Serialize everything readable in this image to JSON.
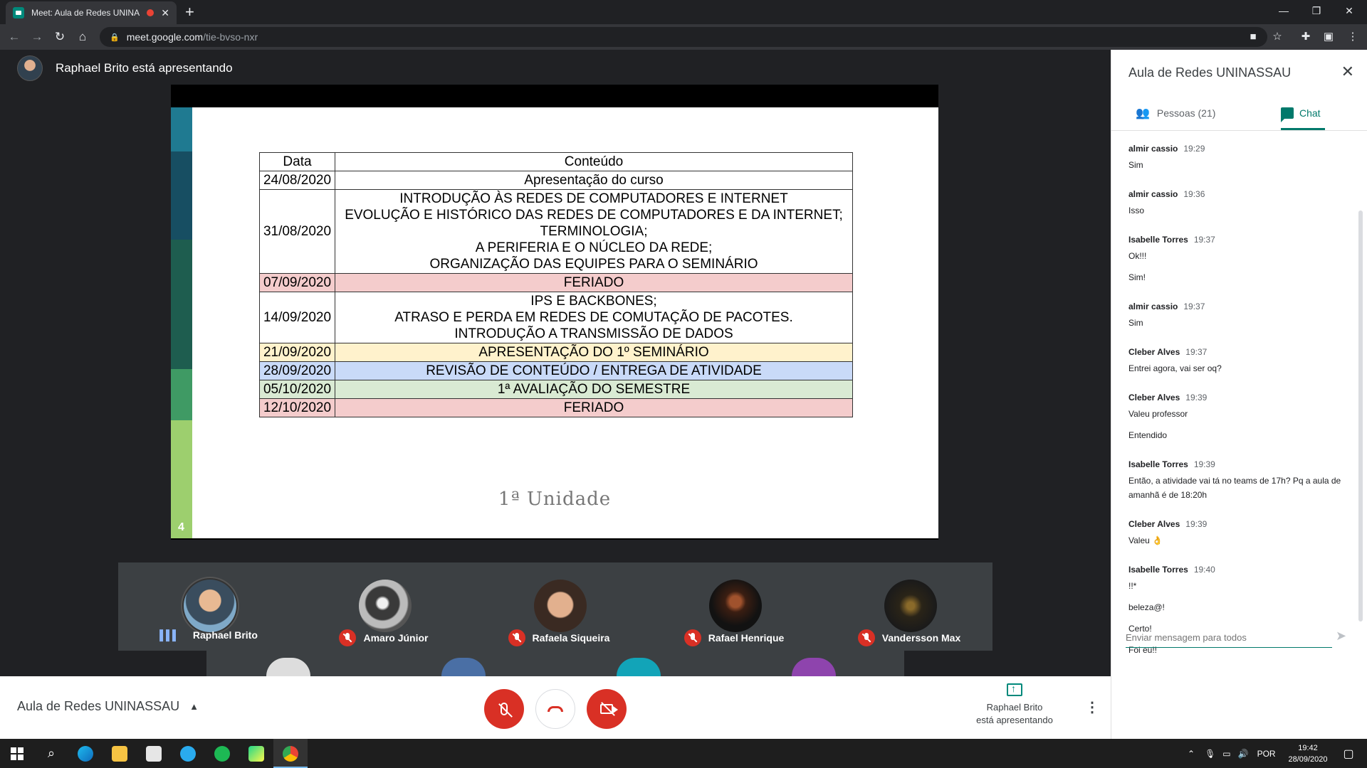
{
  "browser": {
    "tab_title": "Meet: Aula de Redes UNINA",
    "url_host": "meet.google.com",
    "url_path": "/tie-bvso-nxr"
  },
  "presenter": {
    "label": "Raphael Brito está apresentando"
  },
  "slide": {
    "header_date": "Data",
    "header_content": "Conteúdo",
    "rows": [
      {
        "date": "24/08/2020",
        "lines": [
          "Apresentação do curso"
        ],
        "color": "#ffffff"
      },
      {
        "date": "31/08/2020",
        "lines": [
          "INTRODUÇÃO ÀS REDES DE COMPUTADORES E INTERNET",
          "EVOLUÇÃO E HISTÓRICO DAS REDES DE COMPUTADORES E DA INTERNET;",
          "TERMINOLOGIA;",
          "A PERIFERIA E O NÚCLEO DA REDE;",
          "ORGANIZAÇÃO DAS EQUIPES PARA O SEMINÁRIO"
        ],
        "color": "#ffffff"
      },
      {
        "date": "07/09/2020",
        "lines": [
          "FERIADO"
        ],
        "color": "#f4cccc"
      },
      {
        "date": "14/09/2020",
        "lines": [
          "IPS E BACKBONES;",
          "ATRASO E PERDA EM REDES DE COMUTAÇÃO DE PACOTES.",
          "INTRODUÇÃO A TRANSMISSÃO DE DADOS"
        ],
        "color": "#ffffff"
      },
      {
        "date": "21/09/2020",
        "lines": [
          "APRESENTAÇÃO DO 1º SEMINÁRIO"
        ],
        "color": "#fff2cc"
      },
      {
        "date": "28/09/2020",
        "lines": [
          "REVISÃO DE CONTEÚDO / ENTREGA DE ATIVIDADE"
        ],
        "color": "#c9daf8"
      },
      {
        "date": "05/10/2020",
        "lines": [
          "1ª AVALIAÇÃO DO SEMESTRE"
        ],
        "color": "#d9ead3"
      },
      {
        "date": "12/10/2020",
        "lines": [
          "FERIADO"
        ],
        "color": "#f4cccc"
      }
    ],
    "unit_label": "1ª Unidade",
    "page_number": "4"
  },
  "participants": [
    {
      "name": "Raphael Brito",
      "muted": false,
      "speaking_indicator": "▌▌▌"
    },
    {
      "name": "Amaro Júnior",
      "muted": true
    },
    {
      "name": "Rafaela Siqueira",
      "muted": true
    },
    {
      "name": "Rafael Henrique",
      "muted": true
    },
    {
      "name": "Vandersson Max",
      "muted": true
    }
  ],
  "controls": {
    "meeting_title": "Aula de Redes UNINASSAU",
    "present_line1": "Raphael Brito",
    "present_line2": "está apresentando"
  },
  "panel": {
    "title": "Aula de Redes UNINASSAU",
    "tab_people": "Pessoas (21)",
    "tab_chat": "Chat",
    "input_placeholder": "Enviar mensagem para todos",
    "messages": [
      {
        "author": "almir cassio",
        "time": "19:29",
        "lines": [
          "Sim"
        ]
      },
      {
        "author": "almir cassio",
        "time": "19:36",
        "lines": [
          "Isso"
        ]
      },
      {
        "author": "Isabelle Torres",
        "time": "19:37",
        "lines": [
          "Ok!!!",
          "Sim!"
        ]
      },
      {
        "author": "almir cassio",
        "time": "19:37",
        "lines": [
          "Sim"
        ]
      },
      {
        "author": "Cleber Alves",
        "time": "19:37",
        "lines": [
          "Entrei agora, vai ser oq?"
        ]
      },
      {
        "author": "Cleber Alves",
        "time": "19:39",
        "lines": [
          "Valeu professor",
          "Entendido"
        ]
      },
      {
        "author": "Isabelle Torres",
        "time": "19:39",
        "lines": [
          "Então, a atividade vai tá no teams de 17h? Pq a aula de amanhã é de 18:20h"
        ]
      },
      {
        "author": "Cleber Alves",
        "time": "19:39",
        "lines": [
          "Valeu 👌"
        ]
      },
      {
        "author": "Isabelle Torres",
        "time": "19:40",
        "lines": [
          "!!*",
          "beleza@!",
          "Certo!",
          "Foi eu!!"
        ]
      }
    ]
  },
  "taskbar": {
    "language": "POR",
    "time": "19:42",
    "date": "28/09/2020"
  }
}
